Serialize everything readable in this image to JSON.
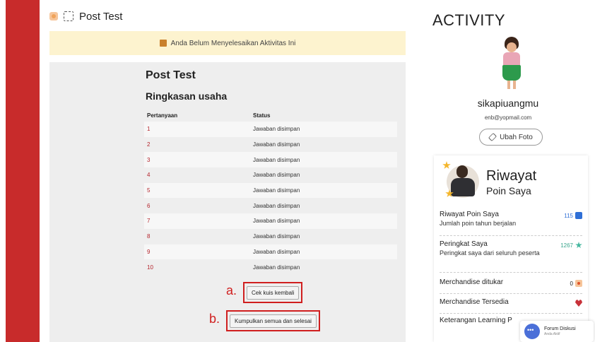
{
  "header": {
    "title": "Post Test"
  },
  "notice": {
    "text": "Anda Belum Menyelesaikan Aktivitas Ini"
  },
  "quiz": {
    "title": "Post Test",
    "summary_title": "Ringkasan usaha",
    "columns": [
      "Pertanyaan",
      "Status"
    ],
    "rows": [
      {
        "q": "1",
        "status": "Jawaban disimpan"
      },
      {
        "q": "2",
        "status": "Jawaban disimpan"
      },
      {
        "q": "3",
        "status": "Jawaban disimpan"
      },
      {
        "q": "4",
        "status": "Jawaban disimpan"
      },
      {
        "q": "5",
        "status": "Jawaban disimpan"
      },
      {
        "q": "6",
        "status": "Jawaban disimpan"
      },
      {
        "q": "7",
        "status": "Jawaban disimpan"
      },
      {
        "q": "8",
        "status": "Jawaban disimpan"
      },
      {
        "q": "9",
        "status": "Jawaban disimpan"
      },
      {
        "q": "10",
        "status": "Jawaban disimpan"
      }
    ],
    "marker_a": "a.",
    "check_again_label": "Cek kuis kembali",
    "marker_b": "b.",
    "submit_label": "Kumpulkan semua dan selesai"
  },
  "sidebar": {
    "title": "ACTIVITY",
    "username": "sikapiuangmu",
    "email": "enb@yopmail.com",
    "change_photo_label": "Ubah Foto",
    "card": {
      "title": "Riwayat",
      "subtitle": "Poin Saya",
      "stats": [
        {
          "label": "Riwayat Poin Saya",
          "desc": "Jumlah poin tahun berjalan",
          "value": "115",
          "icon": "trend-icon",
          "color": "#2f6fd6"
        },
        {
          "label": "Peringkat Saya",
          "desc": "Peringkat saya dari seluruh peserta",
          "value": "1267",
          "icon": "rank-icon",
          "color": "#3aa68c"
        },
        {
          "label": "Merchandise ditukar",
          "desc": "",
          "value": "0",
          "icon": "merch-icon",
          "color": "#222222"
        },
        {
          "label": "Merchandise Tersedia",
          "desc": "",
          "value": "",
          "icon": "heart-icon",
          "color": "#c8323a"
        },
        {
          "label": "Keterangan Learning P",
          "desc": "",
          "value": "",
          "icon": "",
          "color": "#222222"
        }
      ]
    }
  },
  "forum": {
    "title": "Forum Diskusi",
    "subtitle": "Anda Aktif"
  },
  "colors": {
    "left_bar": "#c82b2b",
    "notice_bg": "#fdf3cf",
    "marker_red": "#d01f1f",
    "question_link": "#b4232b"
  }
}
